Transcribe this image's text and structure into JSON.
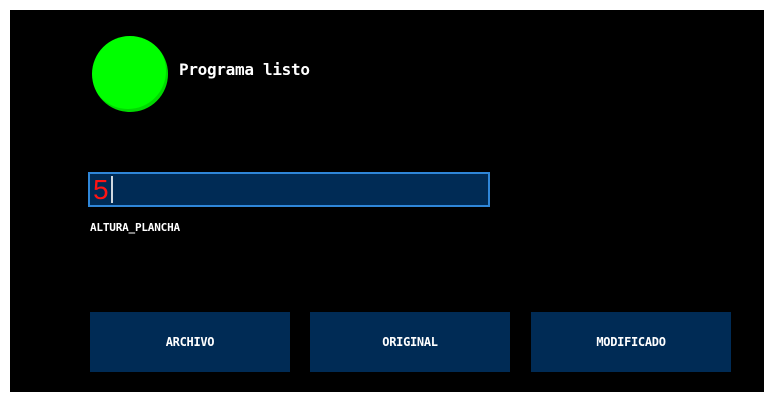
{
  "status": {
    "indicator_color": "#00ff00",
    "text": "Programa listo"
  },
  "field": {
    "value": "5",
    "label": "ALTURA_PLANCHA",
    "value_color": "#ff1414",
    "border_color": "#2f86d8"
  },
  "buttons": {
    "archivo_label": "ARCHIVO",
    "original_label": "ORIGINAL",
    "modificado_label": "MODIFICADO"
  },
  "colors": {
    "panel_background": "#000000",
    "button_background": "#002b55"
  }
}
